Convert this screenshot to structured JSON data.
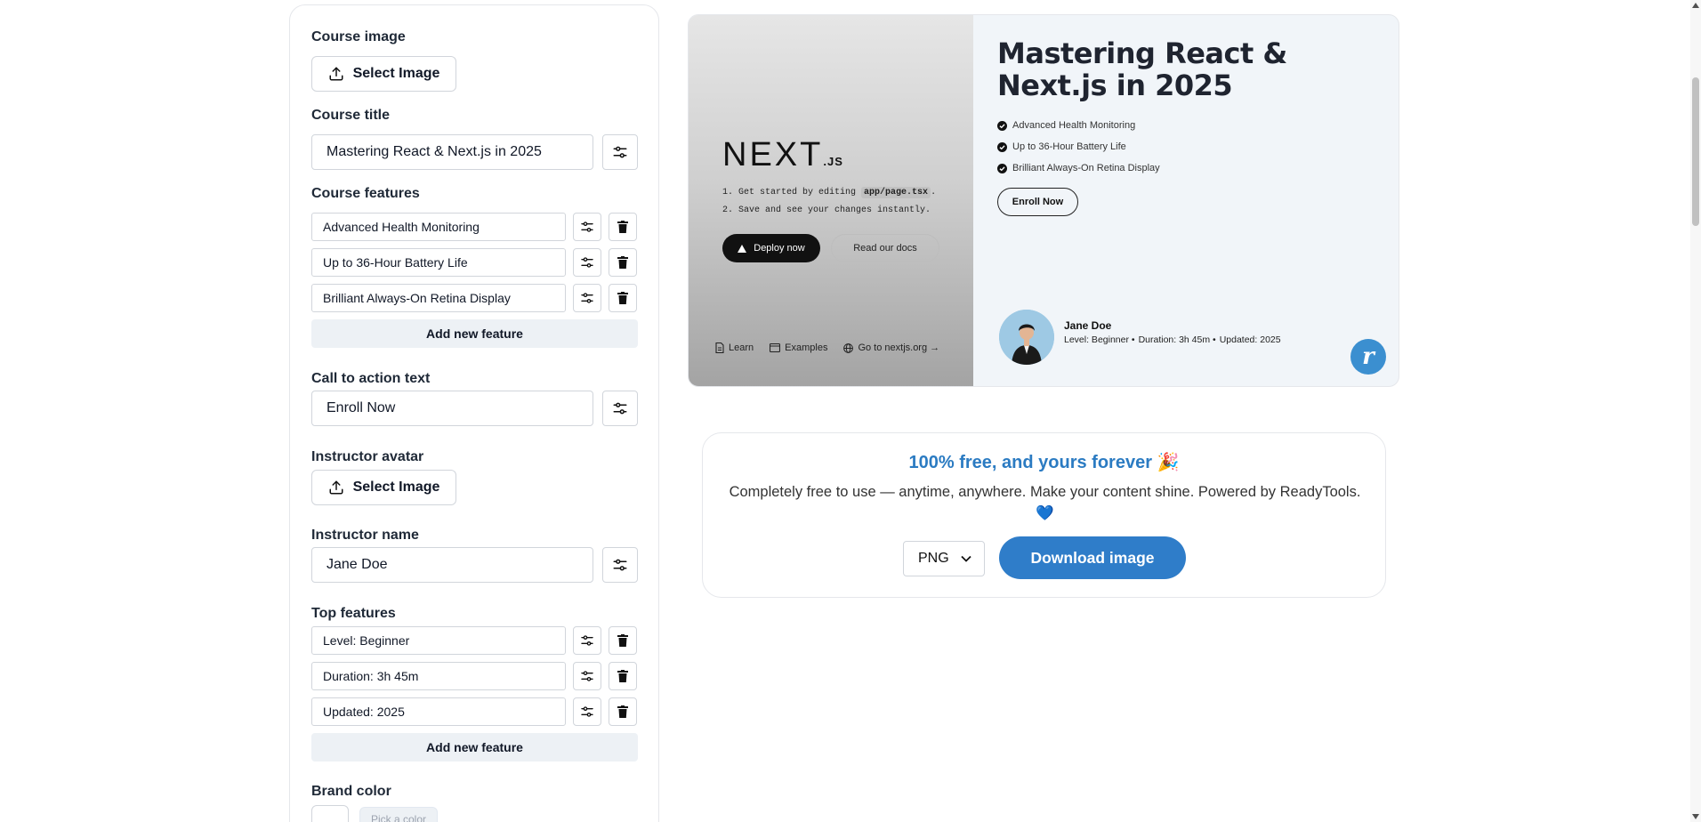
{
  "form": {
    "course_image_label": "Course image",
    "select_image_label": "Select Image",
    "course_title_label": "Course title",
    "course_title_value": "Mastering React & Next.js in 2025",
    "course_features_label": "Course features",
    "course_features": [
      "Advanced Health Monitoring",
      "Up to 36-Hour Battery Life",
      "Brilliant Always-On Retina Display"
    ],
    "add_feature_label": "Add new feature",
    "cta_label": "Call to action text",
    "cta_value": "Enroll Now",
    "instructor_avatar_label": "Instructor avatar",
    "instructor_name_label": "Instructor name",
    "instructor_name_value": "Jane Doe",
    "top_features_label": "Top features",
    "top_features": [
      "Level: Beginner",
      "Duration: 3h 45m",
      "Updated: 2025"
    ],
    "brand_color_label": "Brand color",
    "pick_color_placeholder": "Pick a color"
  },
  "preview": {
    "screenshot": {
      "logo_text": "NEXT",
      "logo_suffix": ".JS",
      "step1_prefix": "1. Get started by editing",
      "step1_code": "app/page.tsx",
      "step1_suffix": ".",
      "step2": "2. Save and see your changes instantly.",
      "deploy_label": "Deploy now",
      "docs_label": "Read our docs",
      "footer_links": [
        "Learn",
        "Examples",
        "Go to nextjs.org →"
      ]
    },
    "title": "Mastering React & Next.js in 2025",
    "features": [
      "Advanced Health Monitoring",
      "Up to 36-Hour Battery Life",
      "Brilliant Always-On Retina Display"
    ],
    "cta": "Enroll Now",
    "instructor_name": "Jane Doe",
    "meta": [
      "Level: Beginner •",
      "Duration: 3h 45m •",
      "Updated: 2025"
    ],
    "brand_logo_letter": "r"
  },
  "banner": {
    "title": "100% free, and yours forever 🎉",
    "description": "Completely free to use — anytime, anywhere. Make your content shine. Powered by ReadyTools. 💙",
    "format_value": "PNG",
    "download_label": "Download image"
  },
  "colors": {
    "accent": "#2f7dc9",
    "title_blue": "#2b7bc2",
    "add_button_bg": "#edf1f5"
  }
}
